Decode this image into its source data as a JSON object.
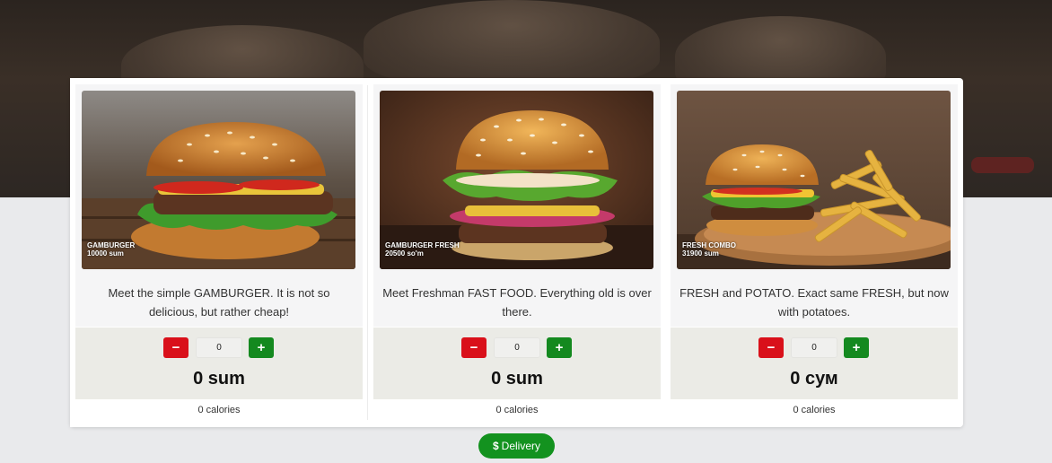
{
  "products": [
    {
      "caption_name": "GAMBURGER",
      "caption_price": "10000 sum",
      "description": "Meet the simple GAMBURGER. It is not so delicious, but rather cheap!",
      "quantity": "0",
      "total": "0 sum",
      "calories": "0 calories",
      "photo_icon": "burger-photo"
    },
    {
      "caption_name": "GAMBURGER FRESH",
      "caption_price": "20500 so'm",
      "description": "Meet Freshman FAST FOOD. Everything old is over there.",
      "quantity": "0",
      "total": "0 sum",
      "calories": "0 calories",
      "photo_icon": "burger-fresh-photo"
    },
    {
      "caption_name": "FRESH COMBO",
      "caption_price": "31900 sum",
      "description": "FRESH and POTATO. Exact same FRESH, but now with potatoes.",
      "quantity": "0",
      "total": "0 сум",
      "calories": "0 calories",
      "photo_icon": "burger-fries-photo"
    }
  ],
  "controls": {
    "minus_symbol": "−",
    "plus_symbol": "+"
  },
  "delivery": {
    "icon": "$",
    "label": "Delivery"
  },
  "colors": {
    "minus": "#d9101a",
    "plus": "#14891f",
    "delivery": "#13921f"
  }
}
